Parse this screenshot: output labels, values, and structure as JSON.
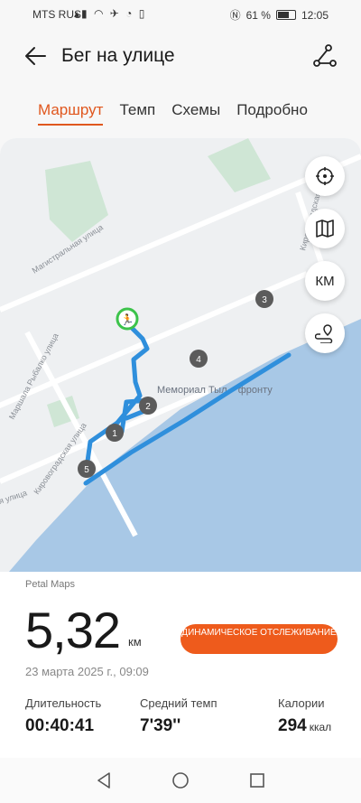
{
  "status": {
    "carrier": "MTS RUS",
    "battery": "61 %",
    "time": "12:05",
    "battery_level": 0.61
  },
  "header": {
    "title": "Бег на улице"
  },
  "tabs": [
    "Маршрут",
    "Темп",
    "Схемы",
    "Подробно"
  ],
  "map": {
    "streets": [
      "Магистральная улица",
      "Маршала Рыбалко улица",
      "Кировоградская улица",
      "Кировоградская улица",
      "я улица"
    ],
    "landmark": "Мемориал Тыл – фронту",
    "markers": [
      "1",
      "2",
      "3",
      "4",
      "5"
    ],
    "buttons": [
      "locate-icon",
      "map-layers-icon",
      "КМ",
      "route-pin-icon"
    ]
  },
  "summary": {
    "source": "Petal Maps",
    "distance": "5,32",
    "distance_unit": "км",
    "dynamic_button": "ДИНАМИЧЕСКОЕ ОТСЛЕЖИВАНИЕ",
    "date": "23 марта 2025 г., 09:09",
    "stats": [
      {
        "label": "Длительность",
        "value": "00:40:41",
        "unit": ""
      },
      {
        "label": "Средний темп",
        "value": "7'39''",
        "unit": ""
      },
      {
        "label": "Калории",
        "value": "294",
        "unit": "ккал"
      }
    ]
  },
  "colors": {
    "accent": "#e0571e",
    "route": "#2f8fdc",
    "water": "#a8c8e6",
    "start": "#3cc34b"
  }
}
